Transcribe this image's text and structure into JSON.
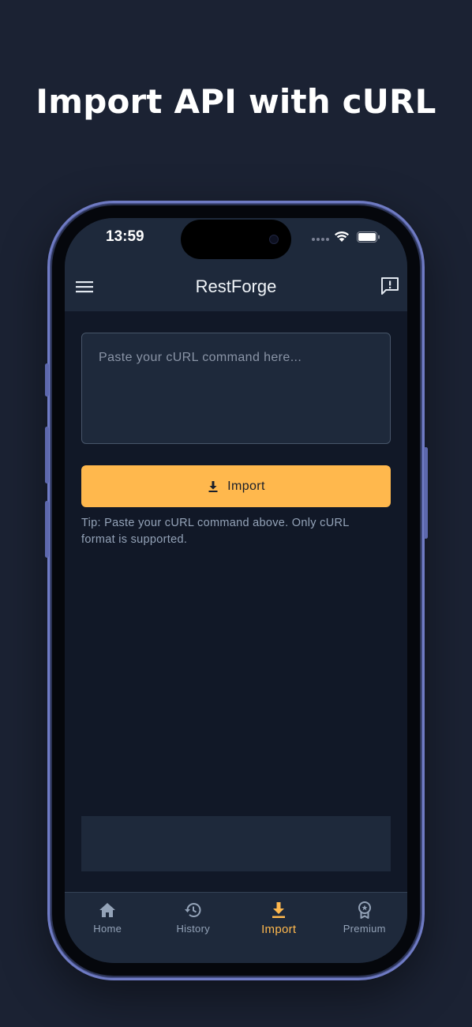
{
  "headline": "Import API with cURL",
  "status_bar": {
    "time": "13:59"
  },
  "app_bar": {
    "title": "RestForge"
  },
  "curl_input": {
    "placeholder": "Paste your cURL command here...",
    "value": ""
  },
  "import_button": {
    "label": "Import"
  },
  "tip": "Tip: Paste your cURL command above. Only cURL format is supported.",
  "bottom_nav": {
    "items": [
      {
        "label": "Home",
        "icon": "home-icon"
      },
      {
        "label": "History",
        "icon": "history-icon"
      },
      {
        "label": "Import",
        "icon": "download-icon",
        "active": true
      },
      {
        "label": "Premium",
        "icon": "premium-badge-icon"
      }
    ]
  },
  "colors": {
    "background": "#1b2233",
    "screen_bg": "#111827",
    "surface": "#1e293b",
    "accent": "#ffb84d",
    "muted_text": "#94a3b8",
    "frame": "#6f7bc4"
  }
}
